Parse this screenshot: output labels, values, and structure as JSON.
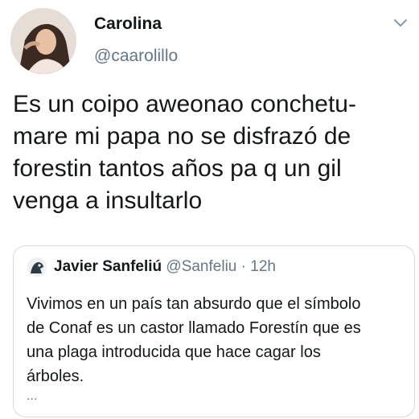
{
  "tweet": {
    "display_name": "Carolina",
    "handle": "@caarolillo",
    "text_lines": [
      "Es un coipo aweonao conchetu-",
      "mare mi papa no se disfrazó de",
      "forestin tantos años pa q un gil",
      "venga a insultarlo"
    ],
    "menu_icon": "chevron-down-icon"
  },
  "quoted_tweet": {
    "display_name": "Javier Sanfeliú",
    "handle": "@Sanfeliu",
    "separator": "·",
    "time": "12h",
    "text_lines": [
      "Vivimos en un país tan absurdo que el símbolo",
      "de Conaf es un castor llamado Forestín que es",
      "una plaga introducida  que hace cagar los",
      "árboles."
    ],
    "more": "..."
  },
  "colors": {
    "text_primary": "#14171a",
    "text_secondary": "#657786",
    "border": "#d5dce1"
  }
}
